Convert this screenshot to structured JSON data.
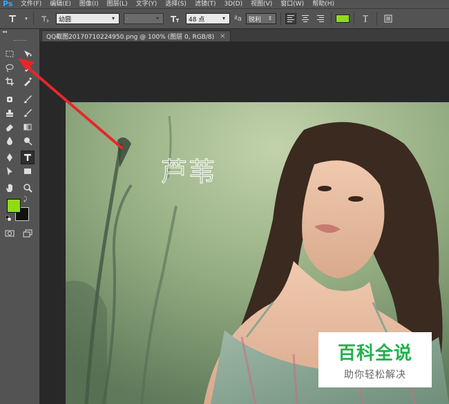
{
  "app": {
    "logo": "Ps"
  },
  "menu": [
    "文件(F)",
    "编辑(E)",
    "图像(I)",
    "图层(L)",
    "文字(Y)",
    "选择(S)",
    "滤镜(T)",
    "3D(D)",
    "视图(V)",
    "窗口(W)",
    "帮助(H)"
  ],
  "options": {
    "font_family": "幼圆",
    "font_style": "-",
    "font_size": "48 点",
    "aa_label": "ªa",
    "antialias": "锐利",
    "text_color": "#8fdc16"
  },
  "tab": {
    "title": "QQ截图20170710224950.png @ 100% (图层 0, RGB/8)",
    "close": "×"
  },
  "canvas": {
    "selection_text": "芦苇"
  },
  "tools": {
    "fg_color": "#8fdc16",
    "bg_color": "#111111"
  },
  "watermark": {
    "main": "百科全说",
    "sub": "助你轻松解决"
  },
  "colors": {
    "annotation_arrow": "#e8262a",
    "accent_green": "#22b14c"
  }
}
